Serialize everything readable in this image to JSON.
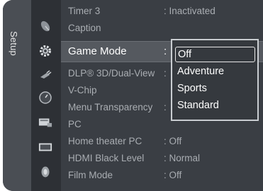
{
  "sidebar": {
    "label": "Setup"
  },
  "icons": [
    "satellite-dish-icon",
    "gear-icon",
    "input-plug-icon",
    "clock-icon",
    "picture-settings-icon",
    "tv-screen-icon",
    "sound-speaker-icon"
  ],
  "menu": {
    "items": [
      {
        "label": "Timer 3",
        "value": ": Inactivated"
      },
      {
        "label": "Caption",
        "value": ""
      },
      {
        "label": "Game Mode",
        "value": ":"
      },
      {
        "label": "DLP® 3D/Dual-View",
        "value": ":"
      },
      {
        "label": "V-Chip",
        "value": ""
      },
      {
        "label": "Menu Transparency",
        "value": ":"
      },
      {
        "label": "PC",
        "value": ""
      },
      {
        "label": "Home theater PC",
        "value": ": Off"
      },
      {
        "label": "HDMI Black Level",
        "value": ": Normal"
      },
      {
        "label": "Film Mode",
        "value": ": Off"
      }
    ],
    "selected_index": 2
  },
  "dropdown": {
    "options": [
      "Off",
      "Adventure",
      "Sports",
      "Standard"
    ],
    "selected": "Off"
  },
  "colors": {
    "panel": "#35393e",
    "menu_bg": "#3a3e44",
    "text_dim": "#a9adb2",
    "text_active": "#ffffff",
    "highlight": "#55595f"
  }
}
